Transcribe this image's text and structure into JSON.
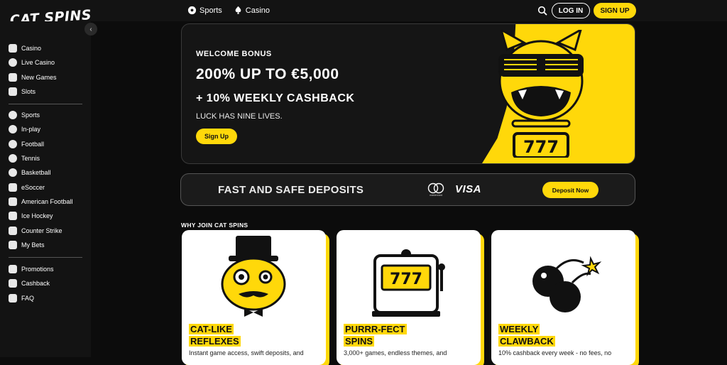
{
  "header": {
    "logo": "CAT SPINS",
    "nav": [
      {
        "label": "Sports",
        "icon": "soccer-ball-icon"
      },
      {
        "label": "Casino",
        "icon": "spade-icon"
      }
    ],
    "login_label": "LOG IN",
    "signup_label": "SIGN UP"
  },
  "sidebar": {
    "groups": [
      [
        {
          "label": "Casino",
          "icon": "flame-icon"
        },
        {
          "label": "Live Casino",
          "icon": "chip-icon"
        },
        {
          "label": "New Games",
          "icon": "lightning-icon"
        },
        {
          "label": "Slots",
          "icon": "spade-icon"
        }
      ],
      [
        {
          "label": "Sports",
          "icon": "soccer-ball-icon"
        },
        {
          "label": "In-play",
          "icon": "play-circle-icon"
        },
        {
          "label": "Football",
          "icon": "football-icon"
        },
        {
          "label": "Tennis",
          "icon": "tennis-ball-icon"
        },
        {
          "label": "Basketball",
          "icon": "basketball-icon"
        },
        {
          "label": "eSoccer",
          "icon": "gamepad-icon"
        },
        {
          "label": "American Football",
          "icon": "american-football-icon"
        },
        {
          "label": "Ice Hockey",
          "icon": "hockey-stick-icon"
        },
        {
          "label": "Counter Strike",
          "icon": "soldier-icon"
        },
        {
          "label": "My Bets",
          "icon": "bets-icon"
        }
      ],
      [
        {
          "label": "Promotions",
          "icon": "gift-icon"
        },
        {
          "label": "Cashback",
          "icon": "cashback-icon"
        },
        {
          "label": "FAQ",
          "icon": "faq-icon"
        }
      ]
    ]
  },
  "hero": {
    "kicker": "WELCOME BONUS",
    "headline": "200% UP TO €5,000",
    "sub": "+ 10% WEEKLY CASHBACK",
    "tagline": "LUCK HAS NINE LIVES.",
    "button": "Sign Up",
    "badge": "777"
  },
  "deposit": {
    "title": "FAST AND SAFE DEPOSITS",
    "mc_label": "mastercard",
    "visa": "VISA",
    "button": "Deposit Now"
  },
  "why": {
    "heading": "WHY JOIN CAT SPINS",
    "cards": [
      {
        "title1": "CAT-LIKE",
        "title2": "REFLEXES",
        "desc": "Instant game access, swift deposits, and"
      },
      {
        "title1": "PURRR-FECT",
        "title2": "SPINS",
        "desc": "3,000+ games, endless themes, and",
        "reels": "777"
      },
      {
        "title1": "WEEKLY",
        "title2": "CLAWBACK",
        "desc": "10% cashback every week -  no fees, no"
      }
    ]
  },
  "colors": {
    "accent": "#ffd80a",
    "background": "#0c0c0c",
    "panel": "#131313"
  }
}
